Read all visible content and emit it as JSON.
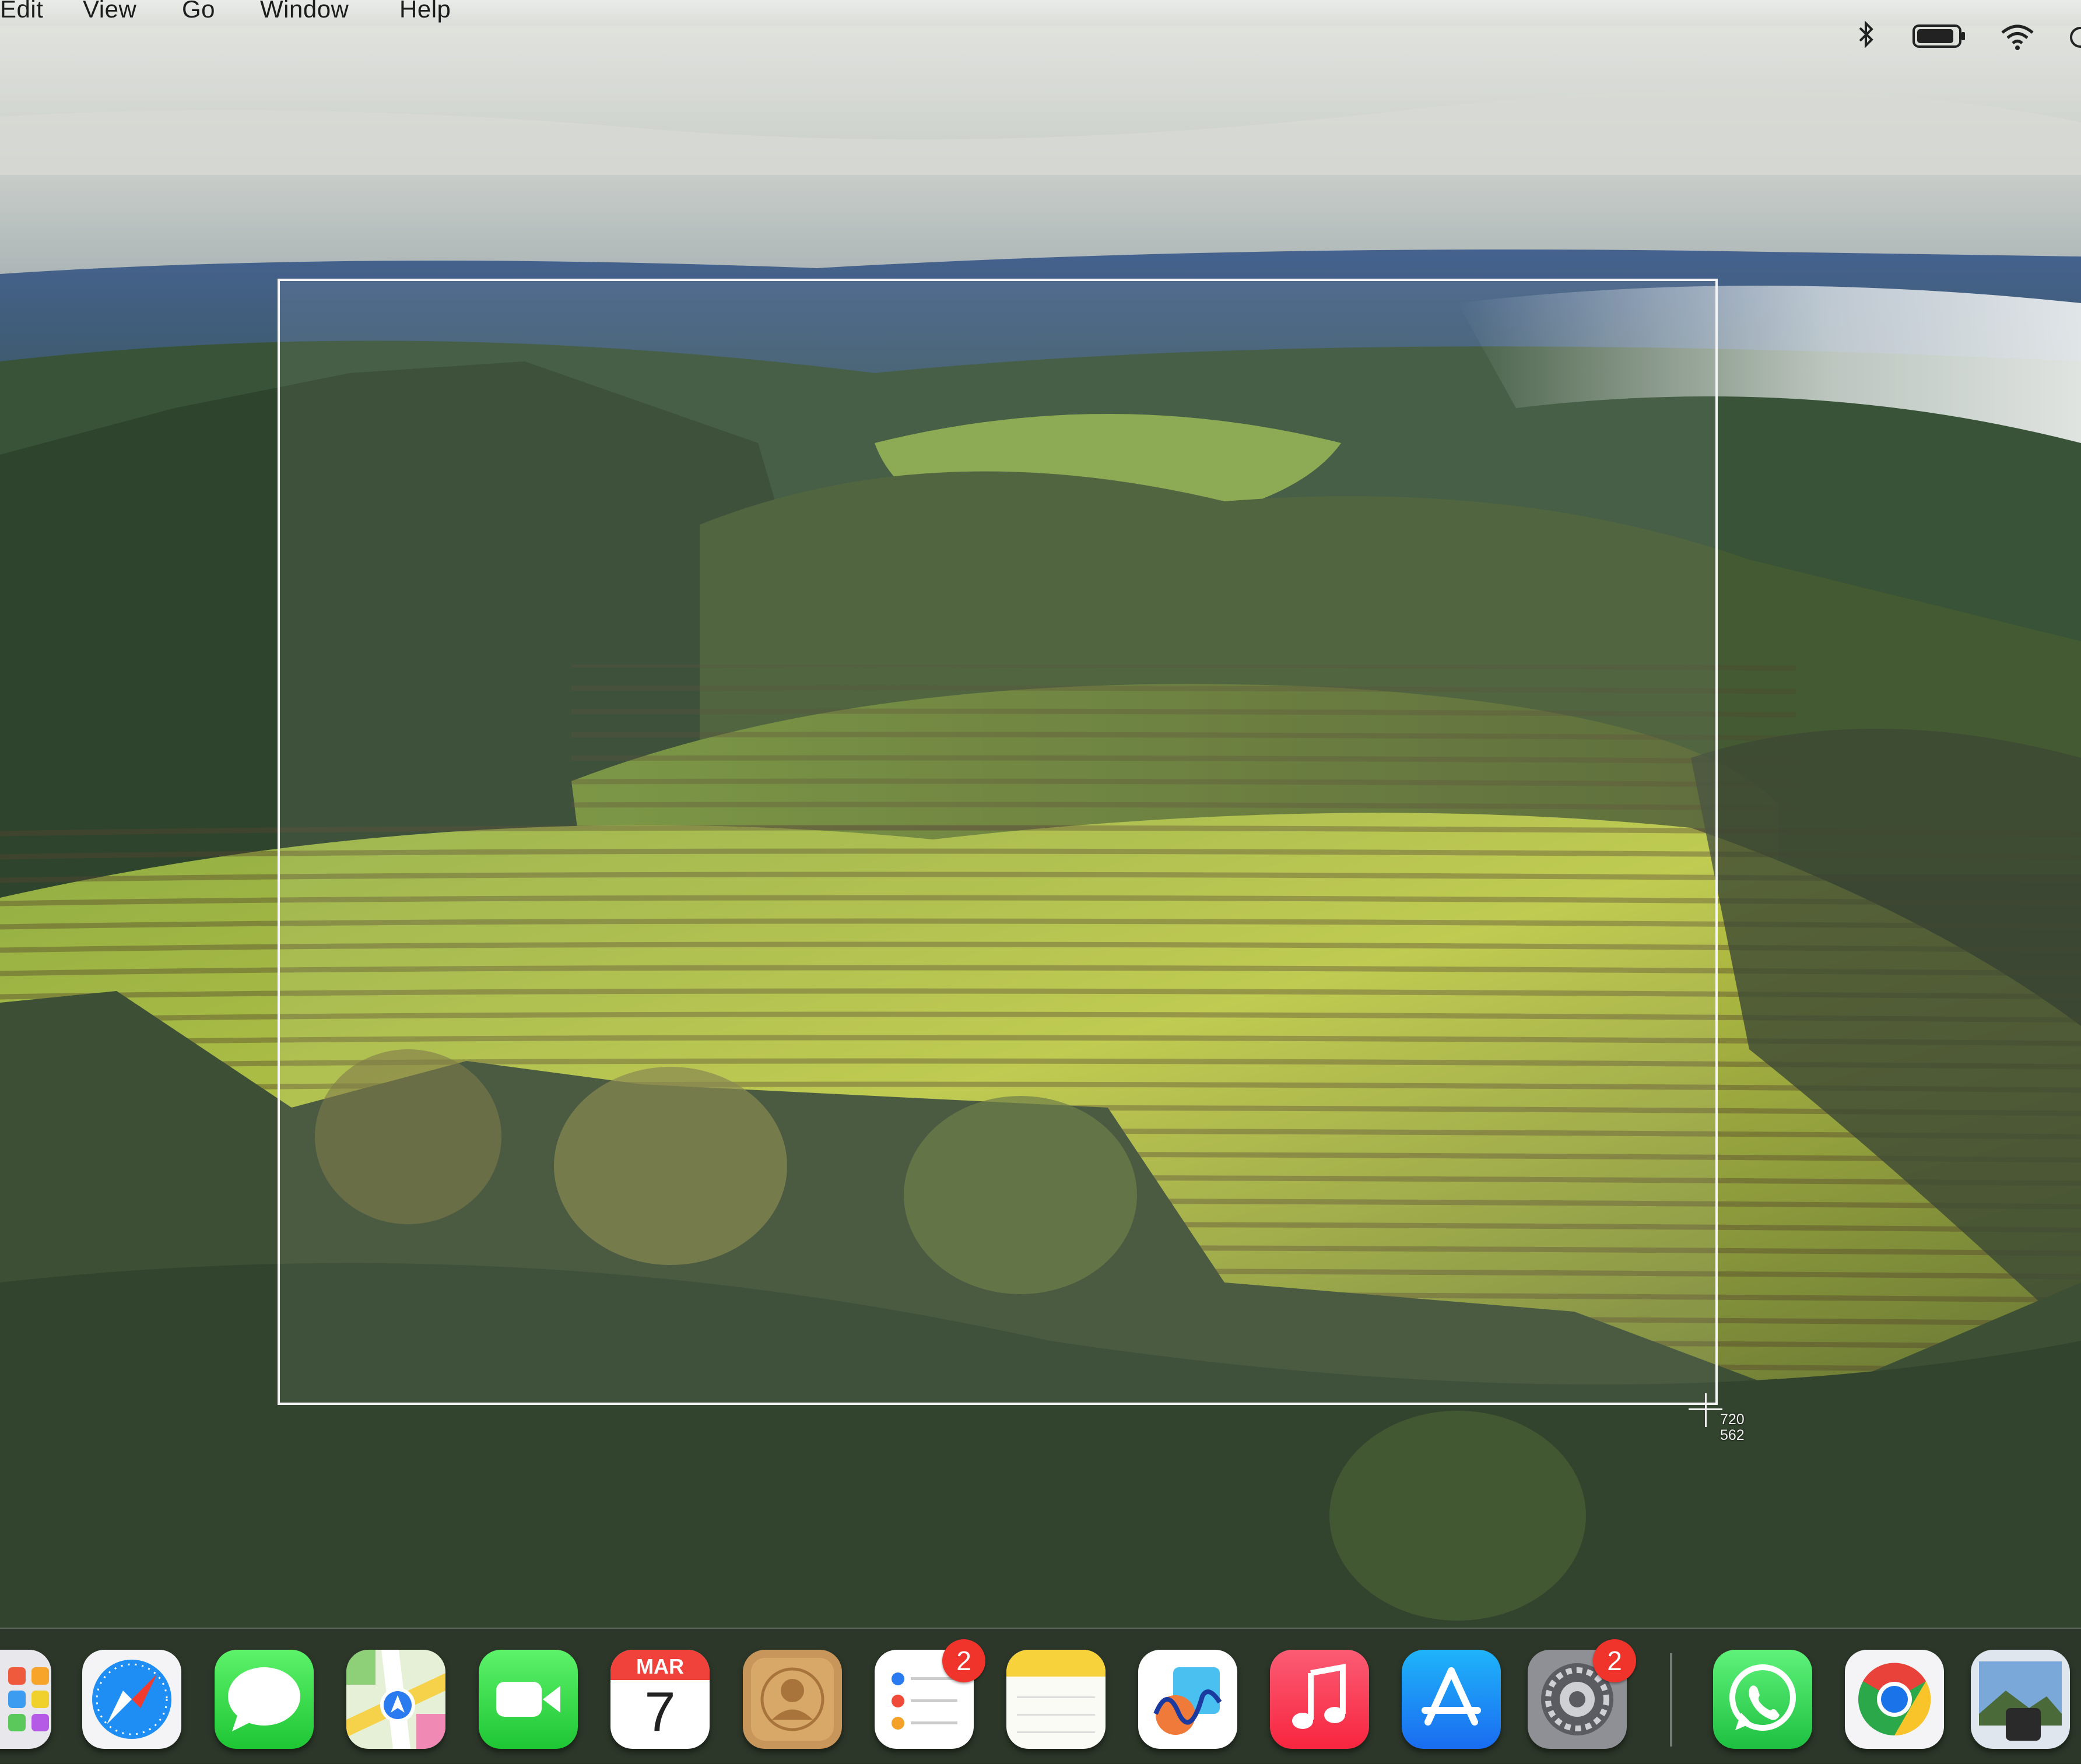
{
  "menubar": {
    "items": [
      "Edit",
      "View",
      "Go",
      "Window",
      "Help"
    ],
    "status_icons": [
      "bluetooth-icon",
      "battery-icon",
      "wifi-icon",
      "control-center-icon"
    ]
  },
  "selection": {
    "width_readout": "720",
    "height_readout": "562"
  },
  "dock": {
    "apps": [
      {
        "name": "Launchpad",
        "icon": "launchpad-icon"
      },
      {
        "name": "Safari",
        "icon": "safari-icon"
      },
      {
        "name": "Messages",
        "icon": "messages-icon"
      },
      {
        "name": "Maps",
        "icon": "maps-icon"
      },
      {
        "name": "FaceTime",
        "icon": "facetime-icon"
      },
      {
        "name": "Calendar",
        "icon": "calendar-icon"
      },
      {
        "name": "Contacts",
        "icon": "contacts-icon"
      },
      {
        "name": "Reminders",
        "icon": "reminders-icon"
      },
      {
        "name": "Notes",
        "icon": "notes-icon"
      },
      {
        "name": "Freeform",
        "icon": "freeform-icon"
      },
      {
        "name": "Music",
        "icon": "music-icon"
      },
      {
        "name": "App Store",
        "icon": "app-store-icon"
      },
      {
        "name": "System Settings",
        "icon": "system-settings-icon"
      },
      {
        "name": "WhatsApp",
        "icon": "whatsapp-icon"
      },
      {
        "name": "Chrome",
        "icon": "chrome-icon"
      },
      {
        "name": "Preview",
        "icon": "preview-icon"
      }
    ],
    "calendar": {
      "month": "MAR",
      "day": "7"
    },
    "badges": {
      "reminders": "2",
      "system_settings": "2"
    }
  },
  "colors": {
    "selection_border": "#f4f4f4",
    "badge": "#f0342c"
  }
}
